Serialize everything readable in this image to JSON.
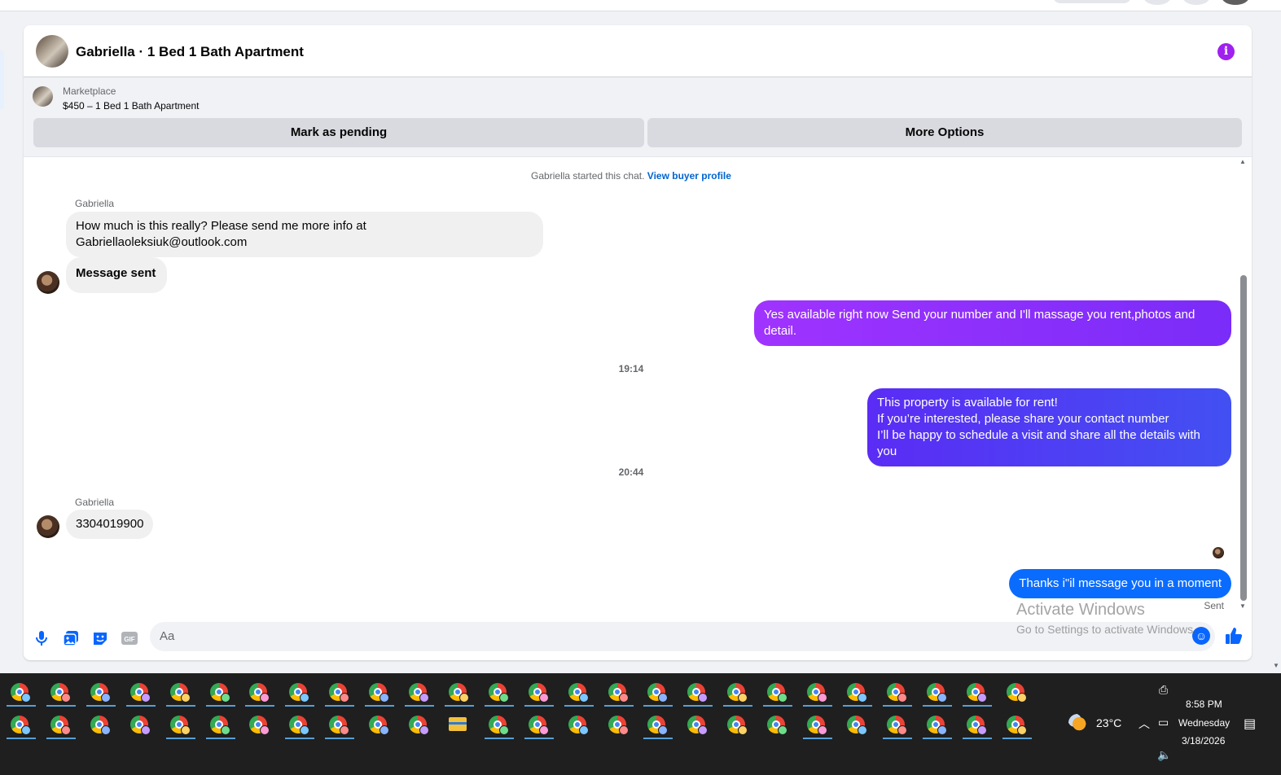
{
  "chat": {
    "title": "Gabriella · 1 Bed 1 Bath Apartment",
    "listing": {
      "source": "Marketplace",
      "price_title": "$450 – 1 Bed 1 Bath Apartment",
      "mark_pending_label": "Mark as pending",
      "more_options_label": "More Options"
    },
    "started_text": "Gabriella started this chat.",
    "view_profile_label": "View buyer profile",
    "messages": [
      {
        "direction": "in",
        "sender": "Gabriella",
        "text": "How much is this really? Please send me more info at Gabriellaoleksiuk@outlook.com"
      },
      {
        "direction": "in",
        "text": "Message sent"
      },
      {
        "direction": "out",
        "text": "Yes available right now Send your number and I'll massage you rent,photos and detail."
      },
      {
        "direction": "time",
        "text": "19:14"
      },
      {
        "direction": "out",
        "text": "This property is available for rent!\nIf you’re interested, please share your contact number\nI’ll be happy to schedule a visit and share all the details with you"
      },
      {
        "direction": "time",
        "text": "20:44"
      },
      {
        "direction": "in",
        "sender": "Gabriella",
        "text": "3304019900"
      },
      {
        "direction": "out",
        "text": "Thanks i\"il message you in a moment"
      }
    ],
    "sent_status": "Sent",
    "composer_placeholder": "Aa",
    "gif_label": "GIF"
  },
  "watermark": {
    "line1": "Activate Windows",
    "line2": "Go to Settings to activate Windows."
  },
  "taskbar": {
    "temperature": "23°C",
    "time": "8:58 PM",
    "day": "Wednesday",
    "date": "3/18/2026"
  },
  "colors": {
    "accent_purple": "#a020f0",
    "bubble_grad_1": "#a033ff",
    "bubble_grad_2": "#5b2cf5",
    "bubble_grad_3": "#4250f2",
    "bubble_blue": "#0a6cff",
    "messenger_blue": "#0866ff"
  }
}
